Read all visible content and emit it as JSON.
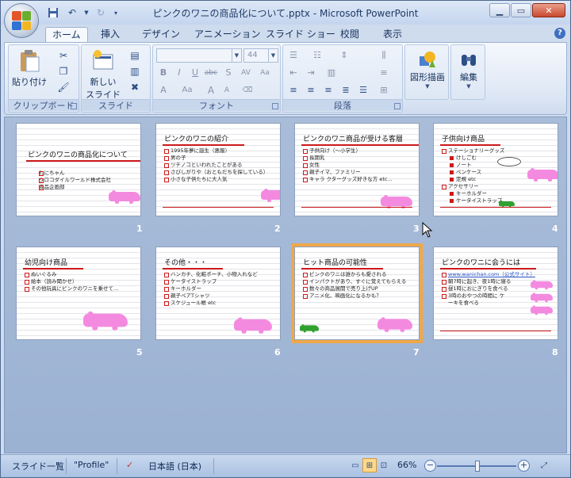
{
  "window": {
    "title": "ピンクのワニの商品化について.pptx - Microsoft PowerPoint"
  },
  "tabs": [
    {
      "label": "ホーム",
      "active": true
    },
    {
      "label": "挿入"
    },
    {
      "label": "デザイン"
    },
    {
      "label": "アニメーション"
    },
    {
      "label": "スライド ショー"
    },
    {
      "label": "校閲"
    },
    {
      "label": "表示"
    }
  ],
  "ribbon": {
    "clipboard": {
      "label": "クリップボード",
      "paste": "貼り付け"
    },
    "slides": {
      "label": "スライド",
      "new_slide_line1": "新しい",
      "new_slide_line2": "スライド"
    },
    "font": {
      "label": "フォント",
      "size": "44"
    },
    "paragraph": {
      "label": "段落"
    },
    "drawing": {
      "label": "図形描画"
    },
    "editing": {
      "label": "編集"
    }
  },
  "slides": [
    {
      "num": "1",
      "title": "ピンクのワニの商品化について",
      "bullets": [],
      "plain": [
        "わにちゃん",
        "クロコダイルワールド株式会社",
        "商品企画部"
      ]
    },
    {
      "num": "2",
      "title": "ピンクのワニの紹介",
      "bullets": [
        "1995年夢に誕生（悪服）",
        "男の子",
        "ツチノコといわれたことがある",
        "さびしがりや（おともだちを探している）",
        "小さな子供たちに大人気"
      ]
    },
    {
      "num": "3",
      "title": "ピンクのワニ商品が受ける客層",
      "bullets": [
        "子供向け（～小学生）",
        "長期乳",
        "女性",
        "親子イマ、ファミリー",
        "キャラ クターグッズ好きな方 etc..."
      ]
    },
    {
      "num": "4",
      "title": "子供向け商品",
      "bullets": [
        "ステーショナリーグッズ",
        "アクセサリー"
      ],
      "subs1": [
        "けしごむ",
        "ノート",
        "ペンケース",
        "定規 etc"
      ],
      "subs2": [
        "キーホルダー",
        "ケータイストラップ"
      ]
    },
    {
      "num": "5",
      "title": "幼児向け商品",
      "bullets": [
        "ぬいぐるみ",
        "絵本（読み聞かせ）",
        "その他玩具にピンクのワニを乗せて…"
      ]
    },
    {
      "num": "6",
      "title": "その他・・・",
      "bullets": [
        "ハンカチ、化粧ポーチ、小物入れなど",
        "ケータイストラップ",
        "キーホルダー",
        "親子ペアTシャツ",
        "スケジュール帳 etc"
      ]
    },
    {
      "num": "7",
      "title": "ヒット商品の可能性",
      "bullets": [
        "ピンクのワニは誰からも愛される",
        "インパクトがあり、すぐに覚えてもらえる",
        "数々の商品展開で売り上げUP",
        "アニメ化、映画化になるかも？"
      ],
      "selected": true
    },
    {
      "num": "8",
      "title": "ピンクのワニに会うには",
      "bullets": [
        "www.wanichan.com（公式サイト）",
        "朝7時に起き、夜1時に寝る",
        "昼1時におにぎりを食べる",
        "3時のおやつの時間に ケーキを食べる"
      ]
    }
  ],
  "status": {
    "view_label": "スライド一覧",
    "theme": "\"Profile\"",
    "language": "日本語 (日本)",
    "zoom": "66%",
    "zoom_level_percent": 66
  },
  "colors": {
    "accent_red": "#cc1a1a",
    "croc_pink": "#f48ae0",
    "selection": "#f0a848"
  }
}
